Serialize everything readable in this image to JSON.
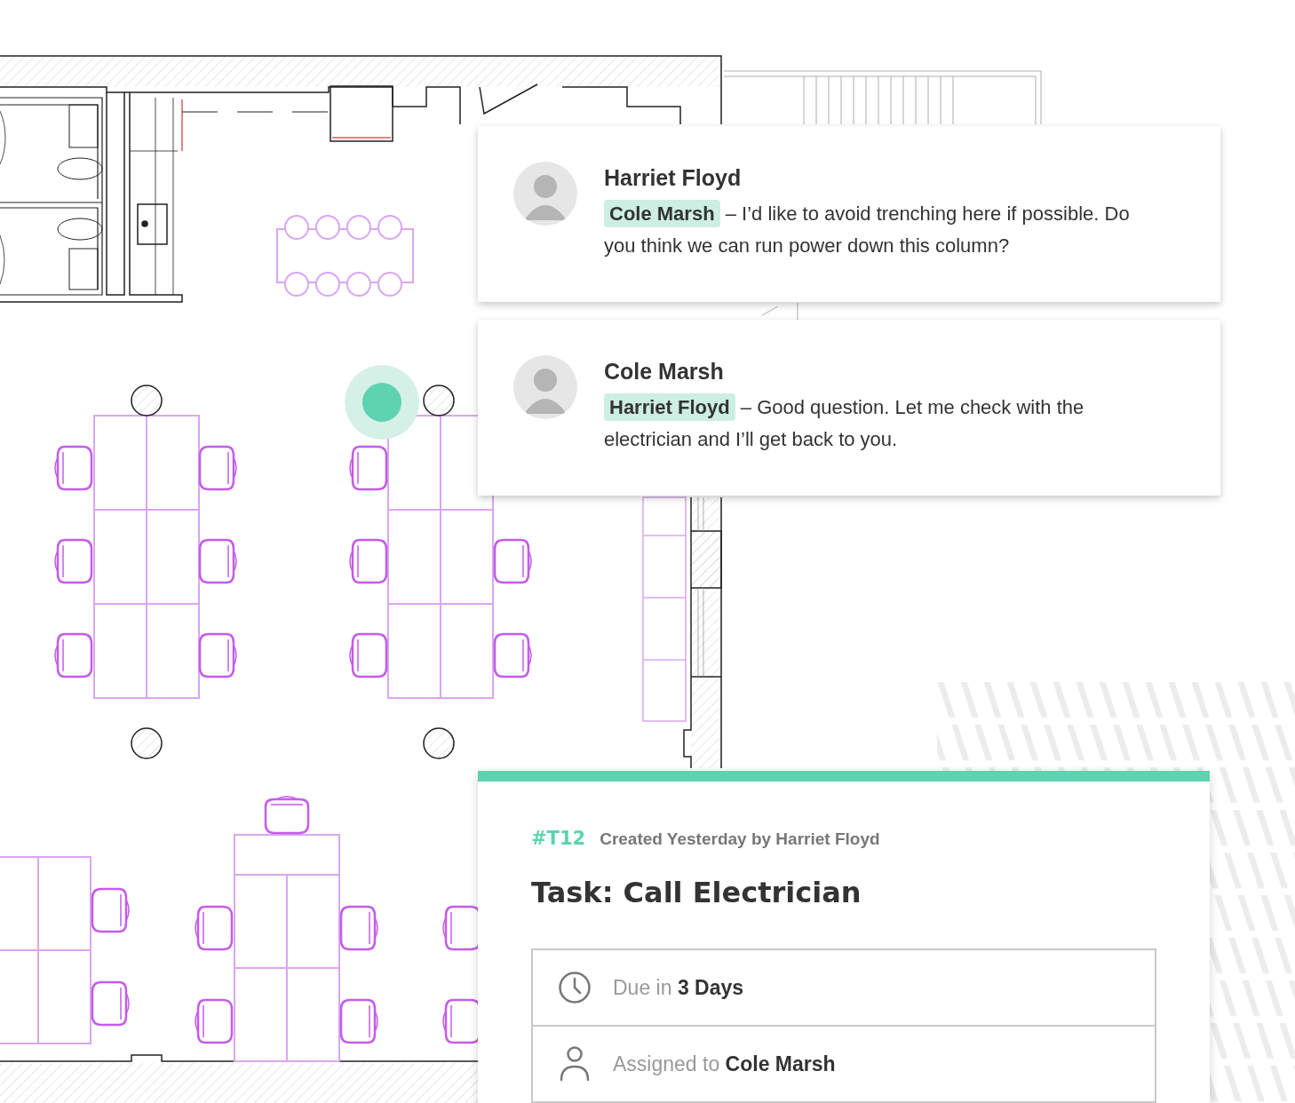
{
  "comments": [
    {
      "author": "Harriet Floyd",
      "mention": "Cole Marsh",
      "text": "– I’d like to avoid trenching here if possible. Do you think we can run power down this column?"
    },
    {
      "author": "Cole Marsh",
      "mention": "Harriet Floyd",
      "text": "– Good question. Let me check with the electrician and I’ll get back to you."
    }
  ],
  "task": {
    "id": "#T12",
    "meta": "Created Yesterday by Harriet Floyd",
    "title": "Task: Call Electrician",
    "details": [
      {
        "kind": "due",
        "label": "Due in",
        "value": "3 Days"
      },
      {
        "kind": "assignee",
        "label": "Assigned to",
        "value": "Cole Marsh"
      }
    ]
  }
}
